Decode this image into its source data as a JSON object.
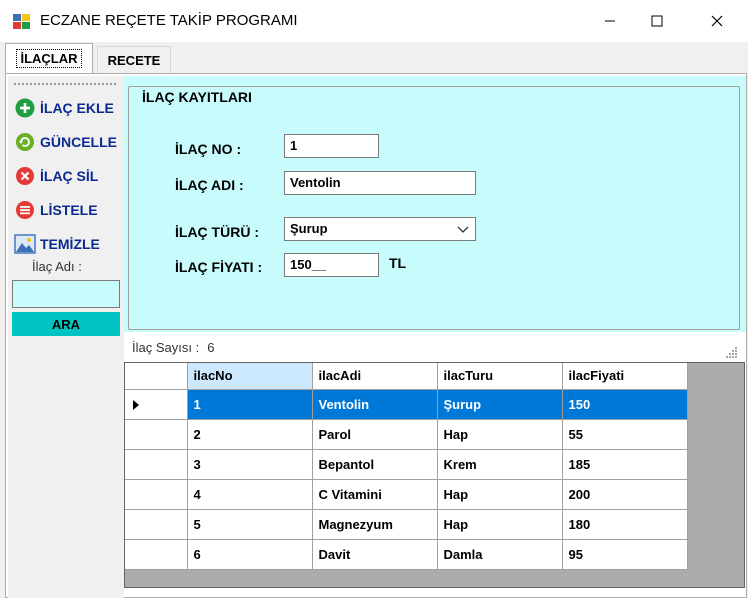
{
  "window": {
    "title": "ECZANE REÇETE TAKİP PROGRAMI",
    "icon": "pharmacy-app-icon"
  },
  "tabs": [
    {
      "label": "İLAÇLAR",
      "active": true
    },
    {
      "label": "RECETE",
      "active": false
    }
  ],
  "toolbar": {
    "items": [
      {
        "label": "İLAÇ EKLE",
        "icon": "plus-circle-icon",
        "color": "#1e9e3e"
      },
      {
        "label": "GÜNCELLE",
        "icon": "refresh-icon",
        "color": "#6ab023"
      },
      {
        "label": "İLAÇ SİL",
        "icon": "delete-circle-icon",
        "color": "#e53935"
      },
      {
        "label": "LİSTELE",
        "icon": "list-icon",
        "color": "#e53935"
      },
      {
        "label": "TEMİZLE",
        "icon": "picture-icon",
        "color": "#3b6fb6"
      }
    ],
    "search_label": "İlaç Adı :",
    "search_value": "",
    "search_button": "ARA"
  },
  "group": {
    "title": "İLAÇ KAYITLARI",
    "fields": {
      "no_label": "İLAÇ NO :",
      "no_value": "1",
      "name_label": "İLAÇ ADI :",
      "name_value": "Ventolin",
      "type_label": "İLAÇ TÜRÜ :",
      "type_value": "Şurup",
      "price_label": "İLAÇ FİYATI :",
      "price_value": "150__",
      "price_unit": "TL"
    }
  },
  "count": {
    "label": "İlaç Sayısı :",
    "value": "6"
  },
  "grid": {
    "columns": [
      "ilacNo",
      "ilacAdi",
      "ilacTuru",
      "ilacFiyati"
    ],
    "rows": [
      [
        "1",
        "Ventolin",
        "Şurup",
        "150"
      ],
      [
        "2",
        "Parol",
        "Hap",
        "55"
      ],
      [
        "3",
        "Bepantol",
        "Krem",
        "185"
      ],
      [
        "4",
        "C Vitamini",
        "Hap",
        "200"
      ],
      [
        "5",
        "Magnezyum",
        "Hap",
        "180"
      ],
      [
        "6",
        "Davit",
        "Damla",
        "95"
      ]
    ],
    "selected_row": 0
  },
  "colors": {
    "panel_bg": "#c8fcfc",
    "selection": "#0078d7",
    "search_button_bg": "#00c4c4",
    "toolbar_text": "#0b2a8f"
  }
}
